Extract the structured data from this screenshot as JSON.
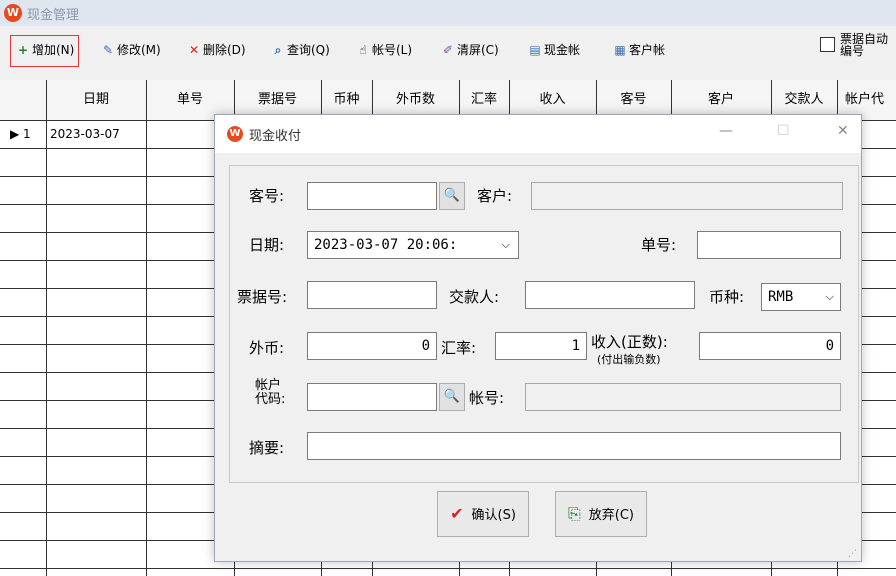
{
  "window": {
    "title": "现金管理"
  },
  "toolbar": {
    "items": [
      {
        "label": "增加(N)",
        "icon": "+"
      },
      {
        "label": "修改(M)",
        "icon": "✎"
      },
      {
        "label": "删除(D)",
        "icon": "✕"
      },
      {
        "label": "查询(Q)",
        "icon": "⌕"
      },
      {
        "label": "帐号(L)",
        "icon": "☝"
      },
      {
        "label": "清屏(C)",
        "icon": "✐"
      },
      {
        "label": "现金帐",
        "icon": "▤"
      },
      {
        "label": "客户帐",
        "icon": "▦"
      }
    ],
    "auto_number_label": "票据自动编号",
    "auto_number_checked": false
  },
  "table": {
    "columns": [
      "日期",
      "单号",
      "票据号",
      "币种",
      "外币数",
      "汇率",
      "收入",
      "客号",
      "客户",
      "交款人",
      "帐户代"
    ],
    "rows": [
      {
        "index": "1",
        "date": "2023-03-07"
      }
    ]
  },
  "dialog": {
    "title": "现金收付",
    "controls": {
      "minimize": "—",
      "maximize": "☐",
      "close": "✕"
    },
    "fields": {
      "customer_no_label": "客号:",
      "customer_no": "",
      "customer_label": "客户:",
      "customer": "",
      "date_label": "日期:",
      "date_value": "2023-03-07 20:06:",
      "order_no_label": "单号:",
      "order_no": "",
      "receipt_no_label": "票据号:",
      "receipt_no": "",
      "payer_label": "交款人:",
      "payer": "",
      "currency_label": "币种:",
      "currency": "RMB",
      "foreign_label": "外币:",
      "foreign_value": "0",
      "rate_label": "汇率:",
      "rate_value": "1",
      "income_label": "收入(正数):",
      "income_sub": "(付出输负数)",
      "income_value": "0",
      "account_code_label": "帐户代码:",
      "account_code": "",
      "account_no_label": "帐号:",
      "account_no": "",
      "summary_label": "摘要:",
      "summary": ""
    },
    "buttons": {
      "confirm": "确认(S)",
      "cancel": "放弃(C)"
    }
  },
  "colors": {
    "accent": "#e8491d",
    "selected_border": "#e23a3a",
    "confirm_check": "#e02020"
  }
}
